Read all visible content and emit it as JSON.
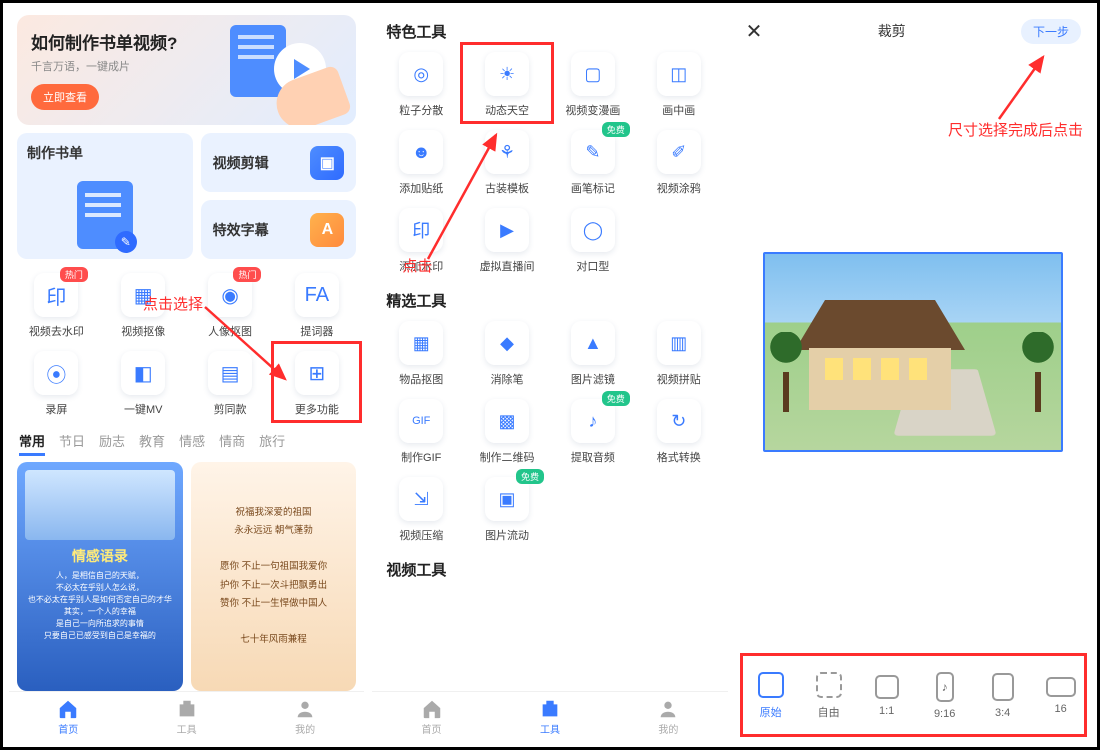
{
  "phone1": {
    "banner": {
      "title": "如何制作书单视频?",
      "subtitle": "千言万语，一键成片",
      "cta": "立即查看"
    },
    "features": {
      "big": "制作书单",
      "small1": "视频剪辑",
      "small2": "特效字幕"
    },
    "tools_row1": [
      {
        "label": "视频去水印",
        "icon": "印",
        "badge": "热门"
      },
      {
        "label": "视频抠像",
        "icon": "▦"
      },
      {
        "label": "人像抠图",
        "icon": "◉",
        "badge": "热门"
      },
      {
        "label": "提词器",
        "icon": "FA"
      }
    ],
    "tools_row2": [
      {
        "label": "录屏",
        "icon": "⦿"
      },
      {
        "label": "一键MV",
        "icon": "◧"
      },
      {
        "label": "剪同款",
        "icon": "▤"
      },
      {
        "label": "更多功能",
        "icon": "⊞",
        "highlight": true
      }
    ],
    "tabs": [
      "常用",
      "节日",
      "励志",
      "教育",
      "情感",
      "情商",
      "旅行"
    ],
    "tab_active": 0,
    "template1": {
      "headline": "情感语录",
      "lines": [
        "人，是相信自己的天赋，",
        "不必太在乎别人怎么说，",
        "也不必太在乎别人是如何否定自己的才华",
        "其实，一个人的幸福",
        "是自己一向所追求的事情",
        "只要自己已感受到自己是幸福的"
      ]
    },
    "template2": {
      "lines": [
        "祝福我深爱的祖国",
        "永永远远 朝气蓬勃",
        "",
        "愿你 不止一句祖国我爱你",
        "护你 不止一次斗把飘勇出",
        "赞你 不止一生悍做中国人",
        "",
        "七十年风雨兼程"
      ]
    },
    "bottomnav": [
      {
        "label": "首页",
        "active": true
      },
      {
        "label": "工具"
      },
      {
        "label": "我的"
      }
    ],
    "anno_select": "点击选择"
  },
  "phone2": {
    "section1": "特色工具",
    "tools1": [
      {
        "label": "粒子分散",
        "icon": "◎"
      },
      {
        "label": "动态天空",
        "icon": "☀",
        "highlight": true
      },
      {
        "label": "视频变漫画",
        "icon": "▢"
      },
      {
        "label": "画中画",
        "icon": "◫"
      },
      {
        "label": "添加贴纸",
        "icon": "☻"
      },
      {
        "label": "古装模板",
        "icon": "⚘"
      },
      {
        "label": "画笔标记",
        "icon": "✎",
        "badge": "免费"
      },
      {
        "label": "视频涂鸦",
        "icon": "✐"
      },
      {
        "label": "添加水印",
        "icon": "印"
      },
      {
        "label": "虚拟直播间",
        "icon": "▶"
      },
      {
        "label": "对口型",
        "icon": "◯"
      }
    ],
    "section2": "精选工具",
    "tools2": [
      {
        "label": "物品抠图",
        "icon": "▦"
      },
      {
        "label": "消除笔",
        "icon": "◆"
      },
      {
        "label": "图片滤镜",
        "icon": "▲"
      },
      {
        "label": "视频拼贴",
        "icon": "▥"
      },
      {
        "label": "制作GIF",
        "icon": "GIF"
      },
      {
        "label": "制作二维码",
        "icon": "▩"
      },
      {
        "label": "提取音频",
        "icon": "♪",
        "badge": "免费"
      },
      {
        "label": "格式转换",
        "icon": "↻"
      },
      {
        "label": "视频压缩",
        "icon": "⇲"
      },
      {
        "label": "图片流动",
        "icon": "▣",
        "badge": "免费"
      }
    ],
    "section3": "视频工具",
    "bottomnav": [
      {
        "label": "首页"
      },
      {
        "label": "工具",
        "active": true
      },
      {
        "label": "我的"
      }
    ],
    "anno_click": "点击"
  },
  "phone3": {
    "title": "裁剪",
    "next": "下一步",
    "anno": "尺寸选择完成后点击",
    "ratios": [
      {
        "label": "原始",
        "active": true,
        "w": 26,
        "h": 26
      },
      {
        "label": "自由",
        "dash": true,
        "w": 26,
        "h": 26
      },
      {
        "label": "1:1",
        "w": 24,
        "h": 24
      },
      {
        "label": "9:16",
        "w": 18,
        "h": 30,
        "note": "♪"
      },
      {
        "label": "3:4",
        "w": 22,
        "h": 28
      },
      {
        "label": "16",
        "w": 30,
        "h": 20
      }
    ]
  }
}
